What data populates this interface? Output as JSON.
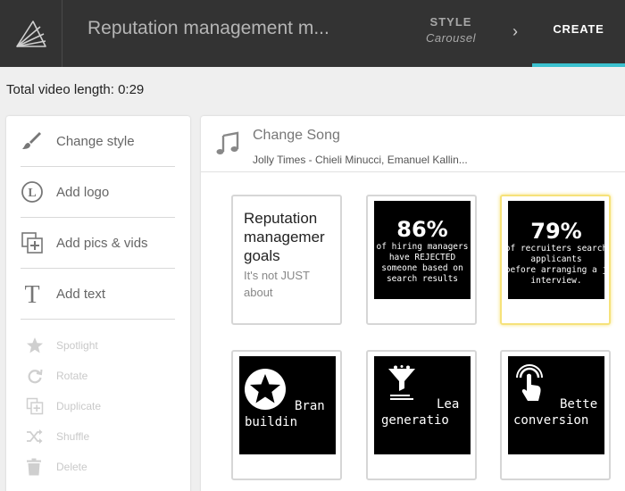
{
  "header": {
    "project_title": "Reputation management m...",
    "style_label": "STYLE",
    "style_value": "Carousel",
    "chevron": "›",
    "create_label": "CREATE"
  },
  "video_length": "Total video length: 0:29",
  "sidebar": {
    "items": [
      {
        "label": "Change style",
        "icon": "brush-icon"
      },
      {
        "label": "Add logo",
        "icon": "logo-l-icon"
      },
      {
        "label": "Add pics & vids",
        "icon": "media-add-icon"
      },
      {
        "label": "Add text",
        "icon": "text-t-icon"
      }
    ],
    "tools": [
      {
        "label": "Spotlight",
        "icon": "star-icon"
      },
      {
        "label": "Rotate",
        "icon": "rotate-icon"
      },
      {
        "label": "Duplicate",
        "icon": "duplicate-icon"
      },
      {
        "label": "Shuffle",
        "icon": "shuffle-icon"
      },
      {
        "label": "Delete",
        "icon": "trash-icon"
      }
    ]
  },
  "song": {
    "title": "Change Song",
    "name": "Jolly Times - Chieli Minucci, Emanuel Kallin..."
  },
  "cards": [
    {
      "type": "text",
      "heading_lines": [
        "Reputation",
        "managemer",
        "goals"
      ],
      "sub_lines": [
        "It's not JUST",
        "about"
      ]
    },
    {
      "type": "stat",
      "number": "86%",
      "lines": [
        "of hiring managers",
        "have REJECTED",
        "someone based on",
        "search results"
      ]
    },
    {
      "type": "stat",
      "number": "79%",
      "lines": [
        "of recruiters search",
        "applicants",
        "before arranging a j",
        "interview."
      ],
      "selected": true
    },
    {
      "type": "icon",
      "icon": "star-badge-icon",
      "lines": [
        "Bran",
        "buildin"
      ]
    },
    {
      "type": "icon",
      "icon": "funnel-icon",
      "lines": [
        "Lea",
        "generatio"
      ]
    },
    {
      "type": "icon",
      "icon": "tap-hand-icon",
      "lines": [
        "Bette",
        "conversion"
      ]
    }
  ],
  "colors": {
    "topbar": "#333333",
    "accent": "#3bc1cf",
    "selected_border": "#f6e27a"
  }
}
